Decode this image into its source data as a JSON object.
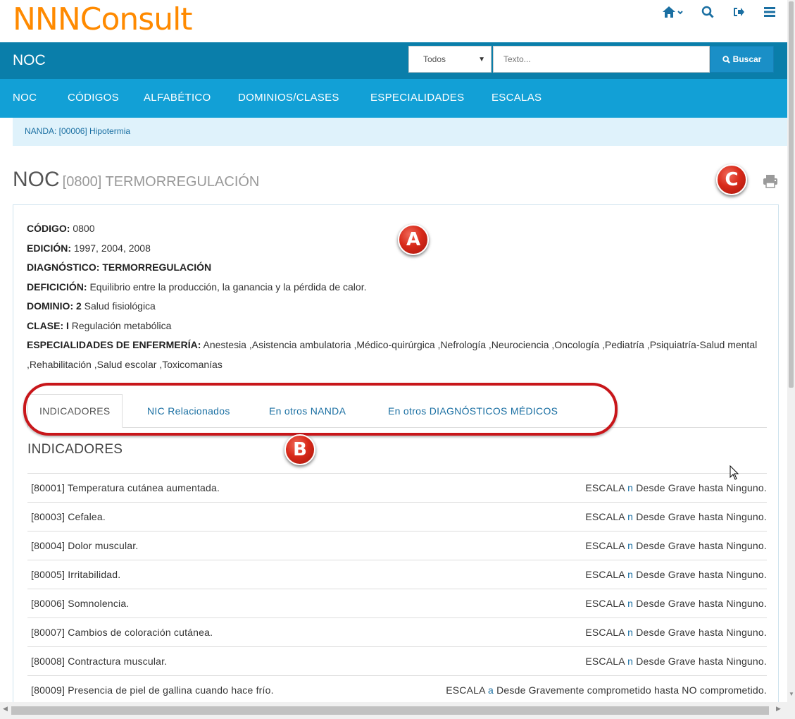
{
  "brand": "NNNConsult",
  "top_icons": [
    "home-icon",
    "search-icon",
    "sign-out-icon",
    "menu-icon"
  ],
  "search": {
    "section_title": "NOC",
    "select_value": "Todos",
    "placeholder": "Texto...",
    "button_label": "Buscar"
  },
  "nav": {
    "items": [
      "NOC",
      "CÓDIGOS",
      "ALFABÉTICO",
      "DOMINIOS/CLASES",
      "ESPECIALIDADES",
      "ESCALAS"
    ]
  },
  "breadcrumb": "NANDA: [00006] Hipotermia",
  "heading": {
    "title": "NOC",
    "subtitle": "[0800] TERMORREGULACIÓN"
  },
  "annotations": {
    "a": "A",
    "b": "B",
    "c": "C"
  },
  "details": {
    "codigo_label": "CÓDIGO:",
    "codigo_value": "0800",
    "edicion_label": "EDICIÓN:",
    "edicion_value": "1997, 2004, 2008",
    "diagnostico_label": "DIAGNÓSTICO:",
    "diagnostico_value": "TERMORREGULACIÓN",
    "deficion_label": "DEFICICIÓN:",
    "deficion_value": "Equilibrio entre la producción, la ganancia y la pérdida de calor.",
    "dominio_label": "DOMINIO: 2",
    "dominio_value": "Salud fisiológica",
    "clase_label": "CLASE: I",
    "clase_value": "Regulación metabólica",
    "especialidades_label": "ESPECIALIDADES DE ENFERMERÍA:",
    "especialidades_value": "Anestesia ,Asistencia ambulatoria ,Médico-quirúrgica ,Nefrología ,Neurociencia ,Oncología ,Pediatría ,Psiquiatría-Salud mental ,Rehabilitación ,Salud escolar ,Toxicomanías"
  },
  "tabs": [
    "INDICADORES",
    "NIC Relacionados",
    "En otros NANDA",
    "En otros DIAGNÓSTICOS MÉDICOS"
  ],
  "indicators": {
    "title": "INDICADORES",
    "rows": [
      {
        "name": "[80001] Temperatura cutánea aumentada.",
        "scale_prefix": "ESCALA",
        "scale_letter": "n",
        "scale_text": "Desde Grave hasta Ninguno."
      },
      {
        "name": "[80003] Cefalea.",
        "scale_prefix": "ESCALA",
        "scale_letter": "n",
        "scale_text": "Desde Grave hasta Ninguno."
      },
      {
        "name": "[80004] Dolor muscular.",
        "scale_prefix": "ESCALA",
        "scale_letter": "n",
        "scale_text": "Desde Grave hasta Ninguno."
      },
      {
        "name": "[80005] Irritabilidad.",
        "scale_prefix": "ESCALA",
        "scale_letter": "n",
        "scale_text": "Desde Grave hasta Ninguno."
      },
      {
        "name": "[80006] Somnolencia.",
        "scale_prefix": "ESCALA",
        "scale_letter": "n",
        "scale_text": "Desde Grave hasta Ninguno."
      },
      {
        "name": "[80007] Cambios de coloración cutánea.",
        "scale_prefix": "ESCALA",
        "scale_letter": "n",
        "scale_text": "Desde Grave hasta Ninguno."
      },
      {
        "name": "[80008] Contractura muscular.",
        "scale_prefix": "ESCALA",
        "scale_letter": "n",
        "scale_text": "Desde Grave hasta Ninguno."
      },
      {
        "name": "[80009] Presencia de piel de gallina cuando hace frío.",
        "scale_prefix": "ESCALA",
        "scale_letter": "a",
        "scale_text": "Desde Gravemente comprometido hasta NO comprometido."
      }
    ]
  },
  "colors": {
    "brand": "#ff8a00",
    "bar_dark": "#0a7eaa",
    "bar_nav": "#12a0d6",
    "link": "#1a6fa2",
    "annotation_red": "#c8161a"
  }
}
